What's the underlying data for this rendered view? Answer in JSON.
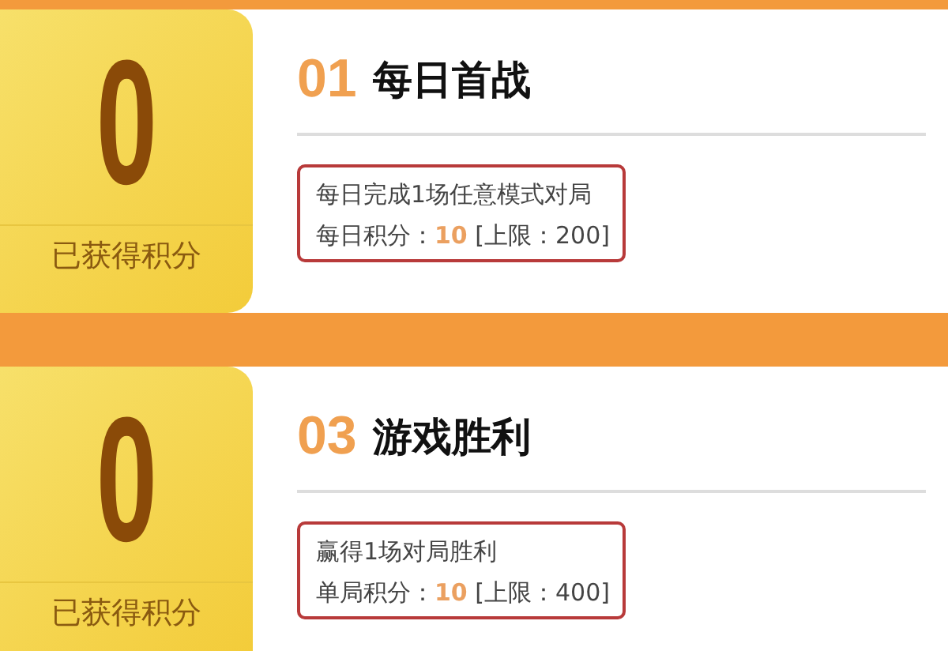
{
  "tasks": [
    {
      "points_earned": "0",
      "points_label": "已获得积分",
      "number": "01",
      "title": "每日首战",
      "description": "每日完成1场任意模式对局",
      "score_line": "每日积分：**10** [上限：200]"
    },
    {
      "points_earned": "0",
      "points_label": "已获得积分",
      "number": "03",
      "title": "游戏胜利",
      "description": "赢得1场对局胜利",
      "score_line": "单局积分：**10** [上限：400]"
    }
  ]
}
